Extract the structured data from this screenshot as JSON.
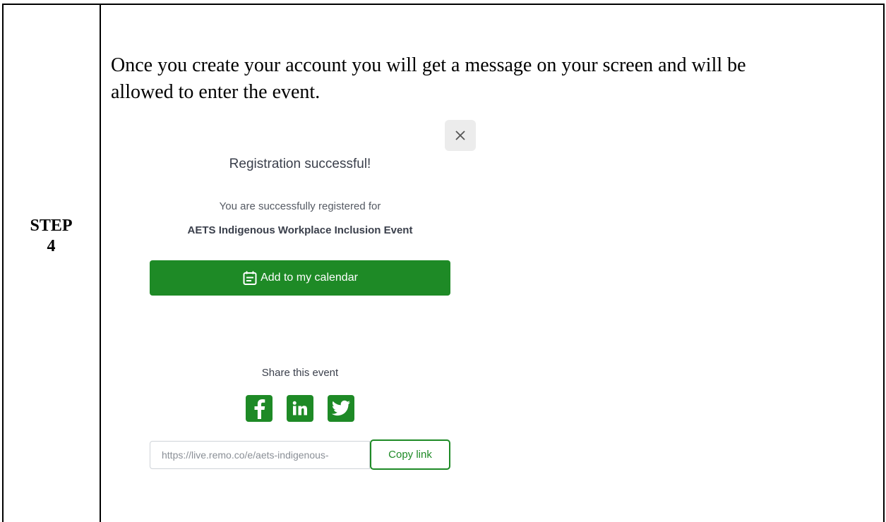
{
  "step": {
    "line1": "STEP",
    "line2": "4"
  },
  "instruction": {
    "line1": "Once you create your account you will get a message on your screen and will be",
    "line2": "allowed to enter the event."
  },
  "dialog": {
    "title": "Registration successful!",
    "subtitle": "You are successfully registered for",
    "event_name": "AETS Indigenous Workplace Inclusion Event",
    "calendar_button": "Add to my calendar",
    "share_label": "Share this event",
    "share_icons": [
      "facebook-icon",
      "linkedin-icon",
      "twitter-icon"
    ],
    "url": "https://live.remo.co/e/aets-indigenous-",
    "copy_button": "Copy link",
    "accent_color": "#1e8a26"
  }
}
